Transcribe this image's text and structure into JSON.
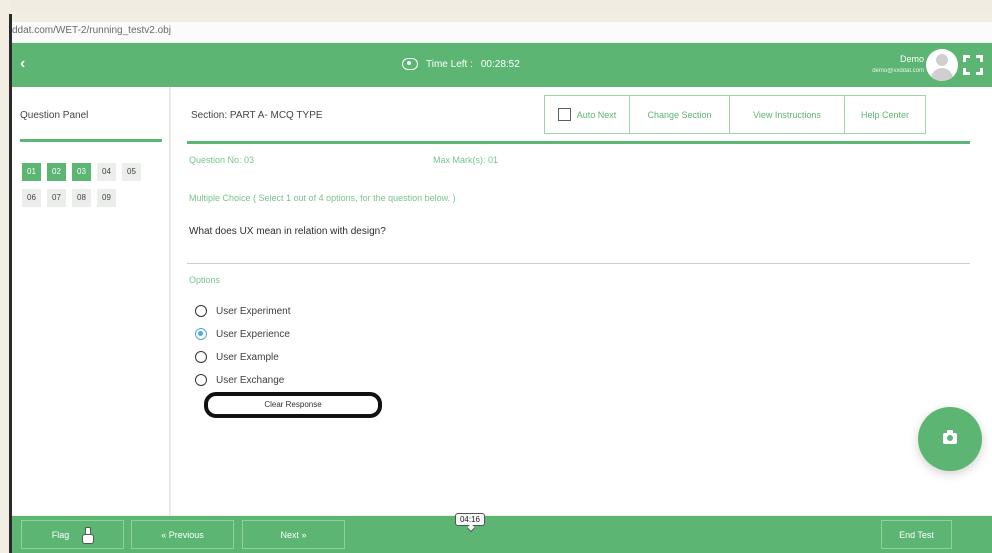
{
  "browser": {
    "url": "ddat.com/WET-2/running_testv2.obj"
  },
  "header": {
    "time_left_label": "Time Left :",
    "time_left_value": "00:28:52",
    "user_name": "Demo",
    "user_email": "demo@xxddat.com"
  },
  "question_panel": {
    "title": "Question Panel",
    "questions": [
      {
        "label": "01",
        "answered": true
      },
      {
        "label": "02",
        "answered": true
      },
      {
        "label": "03",
        "answered": true
      },
      {
        "label": "04",
        "answered": false
      },
      {
        "label": "05",
        "answered": false
      },
      {
        "label": "06",
        "answered": false
      },
      {
        "label": "07",
        "answered": false
      },
      {
        "label": "08",
        "answered": false
      },
      {
        "label": "09",
        "answered": false
      }
    ]
  },
  "main": {
    "section_label": "Section: PART A- MCQ TYPE",
    "tools": {
      "auto_next": "Auto Next",
      "change_section": "Change Section",
      "view_instructions": "View Instructions",
      "help_center": "Help Center"
    },
    "question_no": "Question No: 03",
    "max_marks": "Max Mark(s): 01",
    "instruction": "Multiple Choice ( Select 1 out of 4 options, for the question below. )",
    "question_text": "What does UX mean in relation with design?",
    "options_title": "Options",
    "options": [
      {
        "label": "User Experiment",
        "selected": false
      },
      {
        "label": "User Experience",
        "selected": true
      },
      {
        "label": "User Example",
        "selected": false
      },
      {
        "label": "User Exchange",
        "selected": false
      }
    ],
    "clear_response": "Clear Response"
  },
  "bottom": {
    "flag": "Flag",
    "previous": "« Previous",
    "next": "Next »",
    "end_test": "End Test",
    "video_time": "04:16"
  },
  "colors": {
    "accent": "#5cb573",
    "selected_radio": "#52a8d8"
  },
  "icons": {
    "back": "chevron-left-icon",
    "timer": "eye-timer-icon",
    "fullscreen": "fullscreen-icon",
    "camera": "camera-icon",
    "cursor": "hand-cursor-icon"
  }
}
